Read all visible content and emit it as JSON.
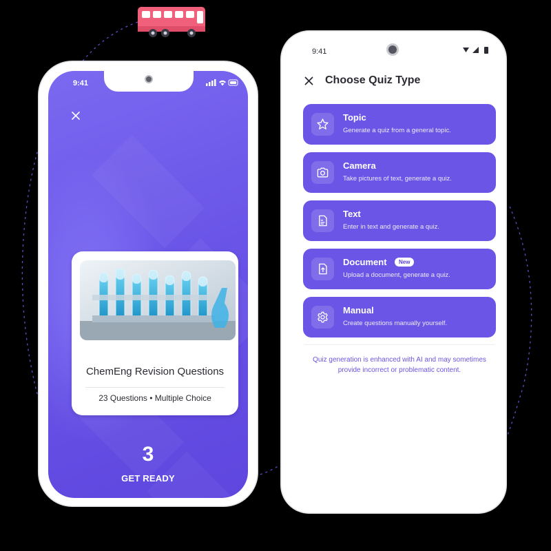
{
  "left_phone": {
    "status_time": "9:41",
    "close_icon": "close-icon",
    "card": {
      "title": "ChemEng Revision Questions",
      "meta": "23 Questions • Multiple Choice"
    },
    "countdown": "3",
    "get_ready": "GET READY"
  },
  "right_phone": {
    "status_time": "9:41",
    "title": "Choose Quiz Type",
    "options": [
      {
        "label": "Topic",
        "description": "Generate a quiz from a general topic.",
        "icon": "star-icon"
      },
      {
        "label": "Camera",
        "description": "Take pictures of text, generate a quiz.",
        "icon": "camera-icon"
      },
      {
        "label": "Text",
        "description": "Enter in text and generate a quiz.",
        "icon": "text-doc-icon"
      },
      {
        "label": "Document",
        "description": "Upload a document, generate a quiz.",
        "icon": "upload-doc-icon",
        "badge": "New"
      },
      {
        "label": "Manual",
        "description": "Create questions manually yourself.",
        "icon": "gear-icon"
      }
    ],
    "disclaimer": "Quiz generation is enhanced with AI and may sometimes provide incorrect or problematic content."
  },
  "colors": {
    "accent": "#6b55e6",
    "left_screen": "#6a55e8",
    "bus": "#f0607a",
    "background": "#000000"
  }
}
